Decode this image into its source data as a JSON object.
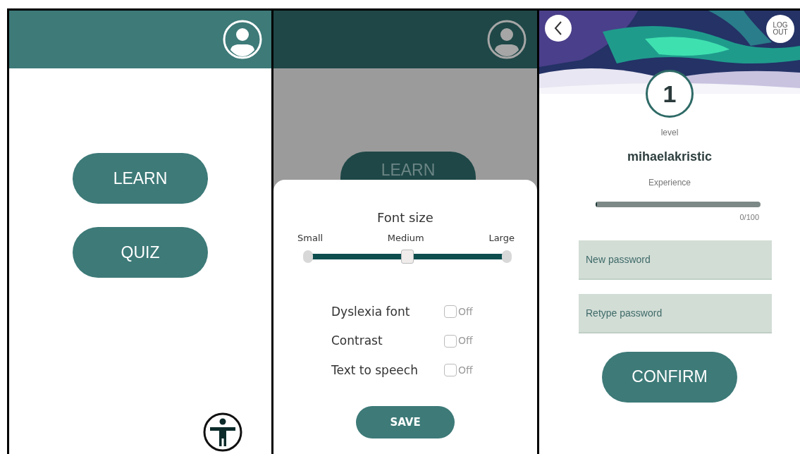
{
  "home_screen": {
    "buttons": [
      {
        "label": "LEARN"
      },
      {
        "label": "QUIZ"
      }
    ]
  },
  "settings_screen": {
    "background_button": {
      "label": "LEARN"
    },
    "title": "Font size",
    "slider": {
      "labels": [
        "Small",
        "Medium",
        "Large"
      ],
      "level": 0.5
    },
    "options": [
      {
        "label": "Dyslexia font",
        "checked": false,
        "state_text": "Off"
      },
      {
        "label": "Contrast",
        "checked": false,
        "state_text": "Off"
      },
      {
        "label": "Text to speech",
        "checked": false,
        "state_text": "Off"
      }
    ],
    "save_button": "SAVE"
  },
  "profile_screen": {
    "logout_button": "LOG OUT",
    "level_number": "1",
    "level_label": "level",
    "username": "mihaelakristic",
    "experience_label": "Experience",
    "experience": {
      "level": 0.01
    },
    "experience_reading": "0/100",
    "fields": [
      {
        "placeholder": "New password"
      },
      {
        "placeholder": "Retype password"
      }
    ],
    "confirm_button": "CONFIRM"
  }
}
